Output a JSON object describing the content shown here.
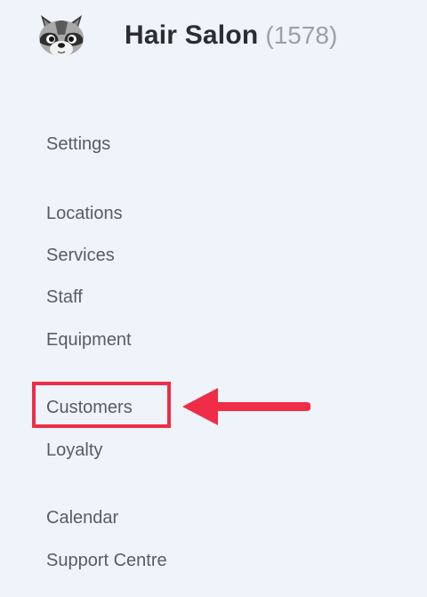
{
  "header": {
    "title": "Hair Salon",
    "count": "(1578)",
    "logo_icon": "raccoon-logo-icon"
  },
  "nav": {
    "settings": "Settings",
    "locations": "Locations",
    "services": "Services",
    "staff": "Staff",
    "equipment": "Equipment",
    "customers": "Customers",
    "loyalty": "Loyalty",
    "calendar": "Calendar",
    "support_centre": "Support Centre"
  },
  "annotation": {
    "highlight_color": "#ef2d47",
    "arrow_icon": "arrow-left-icon"
  },
  "colors": {
    "background": "#eff3fa",
    "title": "#2b2d33",
    "count": "#9da0a7",
    "nav_text": "#595c63"
  }
}
